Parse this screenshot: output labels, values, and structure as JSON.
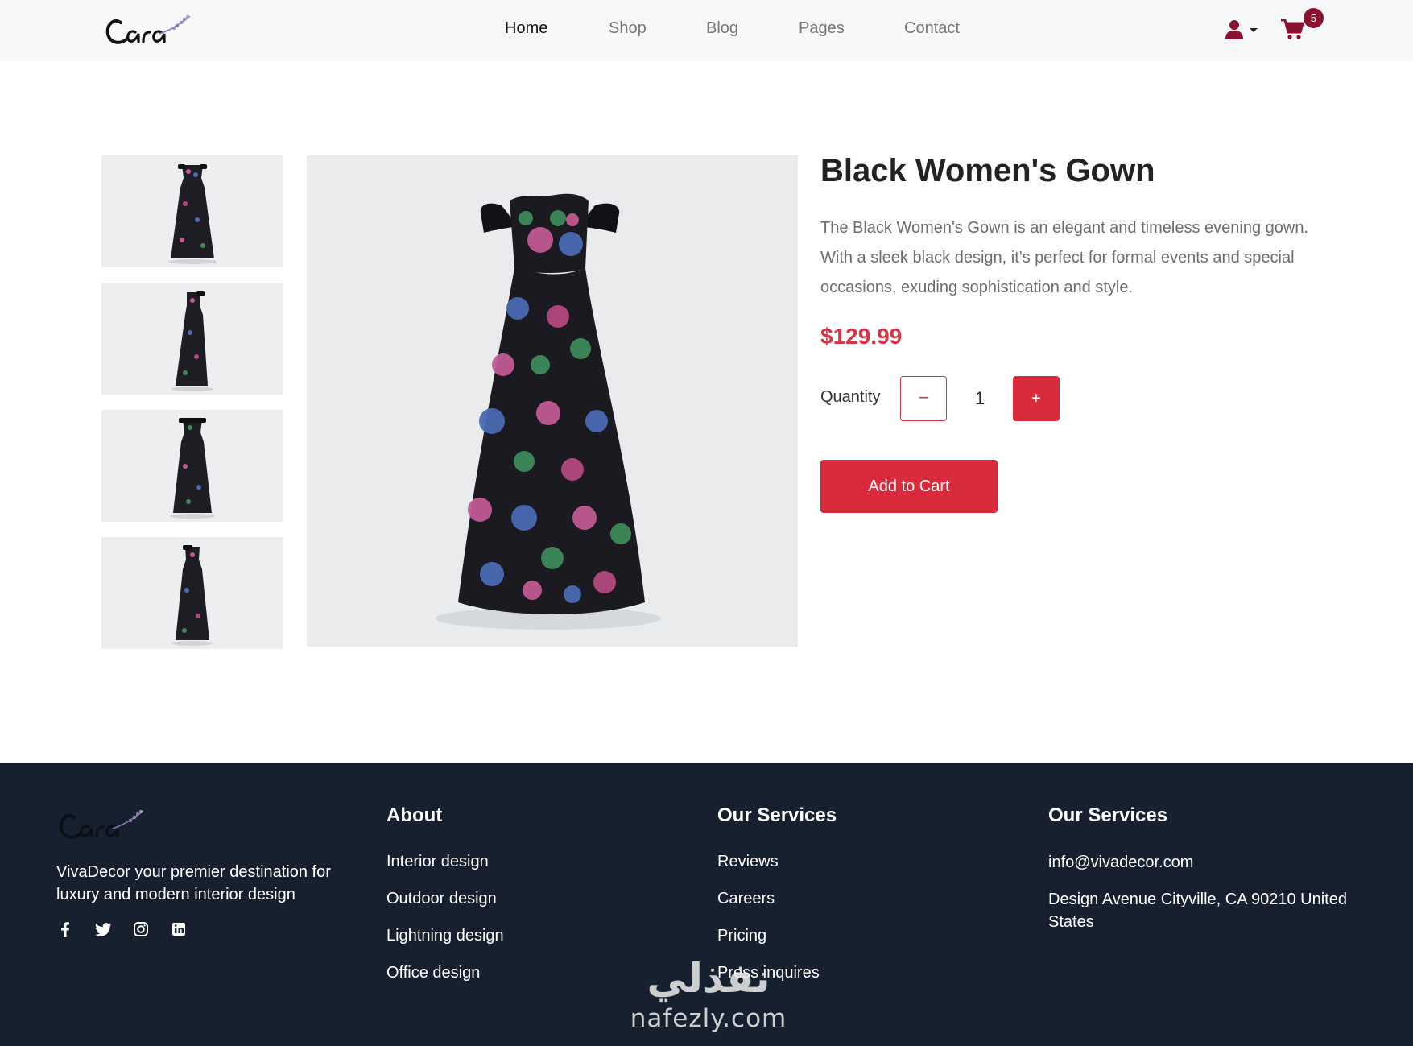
{
  "brand": {
    "logo_text": "Cara"
  },
  "nav": {
    "items": [
      {
        "label": "Home",
        "active": true
      },
      {
        "label": "Shop",
        "active": false
      },
      {
        "label": "Blog",
        "active": false
      },
      {
        "label": "Pages",
        "active": false
      },
      {
        "label": "Contact",
        "active": false
      }
    ]
  },
  "header": {
    "user_icon": "user-icon",
    "cart_icon": "cart-icon",
    "cart_count": "5"
  },
  "product": {
    "title": "Black Women's Gown",
    "description": "The Black Women's Gown is an elegant and timeless evening gown. With a sleek black design, it's perfect for formal events and special occasions, exuding sophistication and style.",
    "price": "$129.99",
    "quantity_label": "Quantity",
    "quantity_value": "1",
    "minus_label": "−",
    "plus_label": "+",
    "add_to_cart_label": "Add to Cart"
  },
  "footer": {
    "logo_text": "Cara",
    "tagline": "VivaDecor your premier destination for luxury and modern interior design",
    "social": [
      "facebook-icon",
      "twitter-icon",
      "instagram-icon",
      "linkedin-icon"
    ],
    "about": {
      "heading": "About",
      "links": [
        "Interior design",
        "Outdoor design",
        "Lightning design",
        "Office design"
      ]
    },
    "services": {
      "heading": "Our Services",
      "links": [
        "Reviews",
        "Careers",
        "Pricing",
        "Press inquires"
      ]
    },
    "contact": {
      "heading": "Our Services",
      "email": "info@vivadecor.com",
      "address": "Design Avenue Cityville, CA 90210 United States"
    }
  },
  "watermark": {
    "arabic": "نفذلي",
    "latin": "nafezly.com"
  },
  "colors": {
    "accent": "#d92b3c",
    "footer_bg": "#16202f",
    "badge": "#8a1230"
  }
}
